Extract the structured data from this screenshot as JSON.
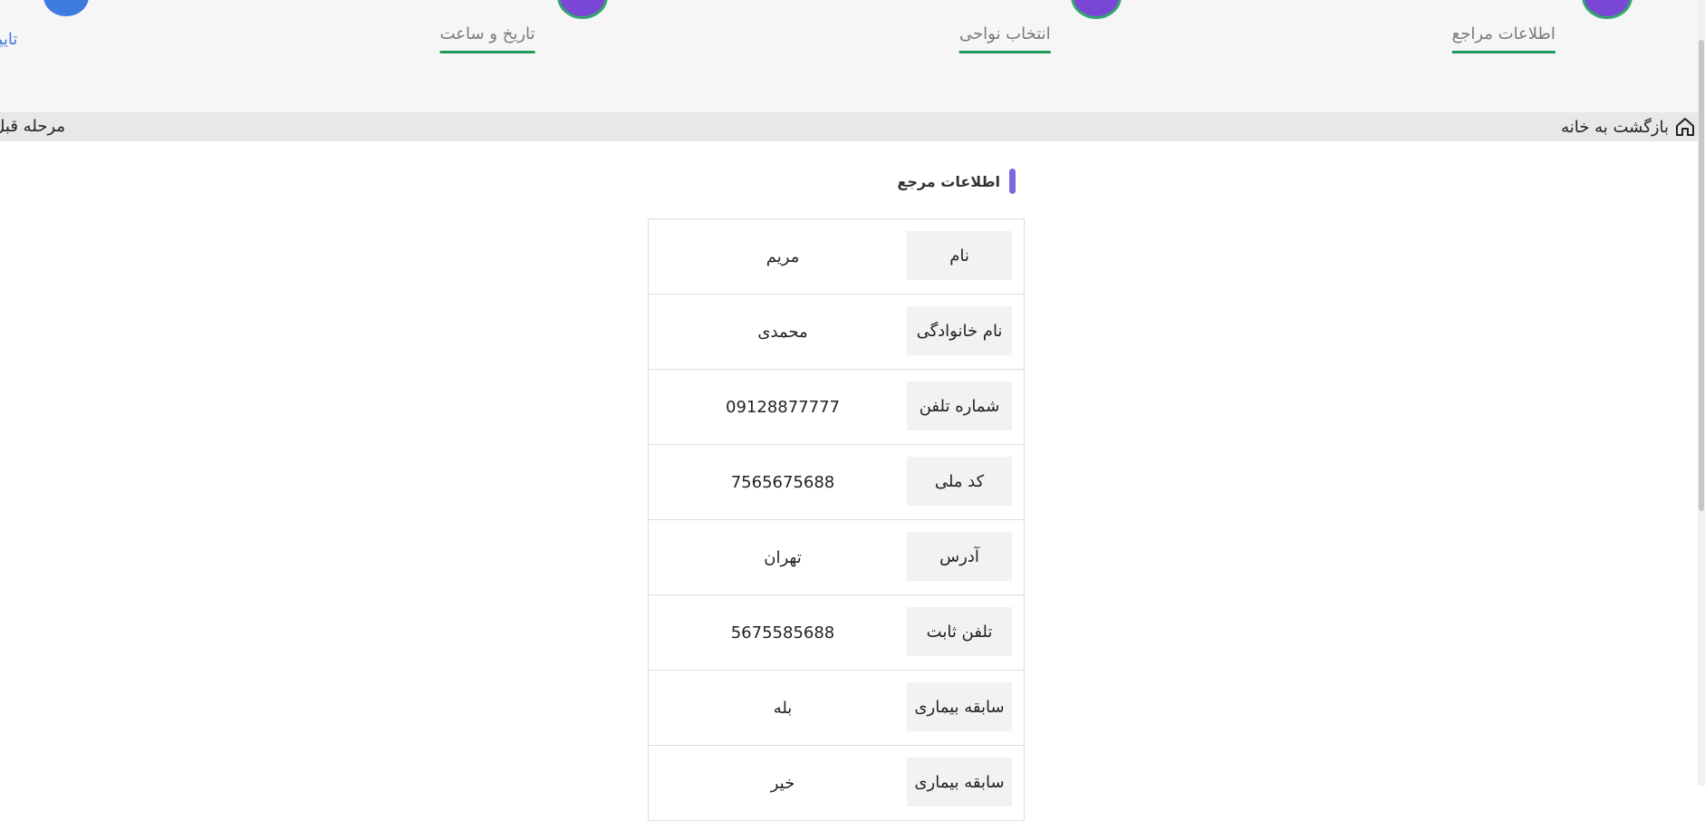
{
  "steps": [
    {
      "label": "اطلاعات مراجع",
      "state": "done"
    },
    {
      "label": "انتخاب نواحی",
      "state": "done"
    },
    {
      "label": "تاریخ و ساعت",
      "state": "done"
    },
    {
      "label": "تایید و پرداخت",
      "state": "active"
    }
  ],
  "nav": {
    "home_label": "بازگشت به خانه",
    "prev_label": "مرحله قبل"
  },
  "section": {
    "title": "اطلاعات مرجع"
  },
  "table": {
    "rows": [
      {
        "label": "نام",
        "value": "مریم"
      },
      {
        "label": "نام خانوادگی",
        "value": "محمدی"
      },
      {
        "label": "شماره تلفن",
        "value": "09128877777"
      },
      {
        "label": "کد ملی",
        "value": "7565675688"
      },
      {
        "label": "آدرس",
        "value": "تهران"
      },
      {
        "label": "تلفن ثابت",
        "value": "5675585688"
      },
      {
        "label": "سابقه بیماری",
        "value": "بله"
      },
      {
        "label": "سابقه بیماری",
        "value": "خیر"
      }
    ]
  },
  "colors": {
    "step_done_circle": "#7a46d6",
    "step_active": "#3d7be0",
    "step_underline": "#1f9a5a",
    "section_bar": "#7a6ae0"
  }
}
